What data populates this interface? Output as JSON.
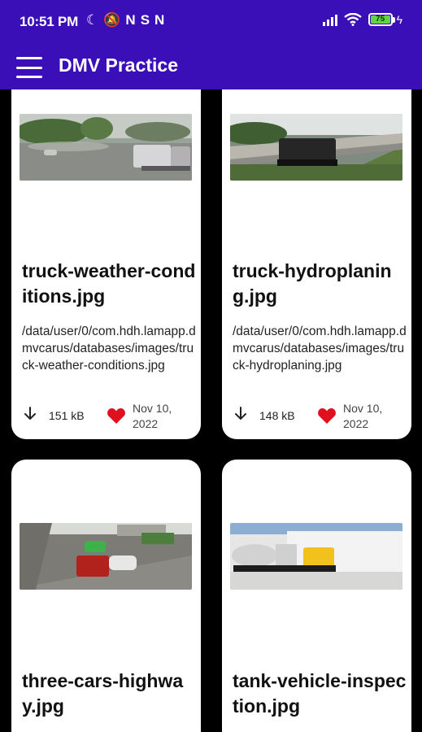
{
  "status_bar": {
    "time": "10:51 PM",
    "left_icons": [
      "moon-icon",
      "mute-icon",
      "n-icon",
      "s-icon",
      "n-icon"
    ],
    "battery_level": "75"
  },
  "app_bar": {
    "title": "DMV Practice"
  },
  "cards": [
    {
      "name": "truck-weather-conditions.jpg",
      "path": "/data/user/0/com.hdh.lamapp.dmvcarus/databases/images/truck-weather-conditions.jpg",
      "size": "151 kB",
      "date": "Nov 10, 2022",
      "favorite": true
    },
    {
      "name": "truck-hydroplaning.jpg",
      "path": "/data/user/0/com.hdh.lamapp.dmvcarus/databases/images/truck-hydroplaning.jpg",
      "size": "148 kB",
      "date": "Nov 10, 2022",
      "favorite": true
    },
    {
      "name": "three-cars-highway.jpg"
    },
    {
      "name": "tank-vehicle-inspection.jpg"
    }
  ],
  "colors": {
    "app_bar": "#3a0fb7",
    "heart": "#e0101e",
    "card": "#ffffff",
    "background": "#000000"
  }
}
